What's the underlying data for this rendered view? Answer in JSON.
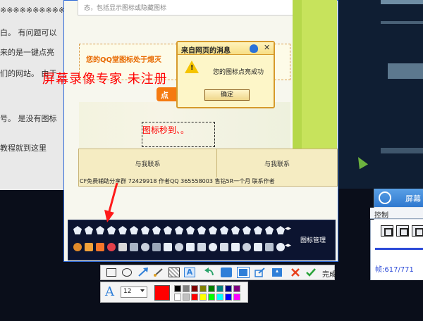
{
  "background_article": {
    "lines": [
      "※※※※※※※※※※※",
      "白。 有问题可以",
      "来的是一键点亮",
      "们的网站。 由于",
      "号。 是没有图标",
      "    教程就到这里"
    ]
  },
  "page": {
    "article_snippet": "态，包括显示图标或隐藏图标",
    "promo_text": "您的QQ堂图标处于熄灭",
    "orange_button": "点",
    "watermark": "屏幕录像专家  未注册",
    "selection_text": "图标秒到、。",
    "contact_left": "与我联系",
    "contact_right": "与我联系",
    "contact_footer": "CF免费辅助分享群  72429918    作者QQ  365558003              售钻5R一个月  联系作者"
  },
  "dialog": {
    "title": "来自网页的消息",
    "close": "✕",
    "warning_mark": "!",
    "message": "您的图标点亮成功",
    "ok_label": "确定"
  },
  "icon_panel": {
    "label": "图标管理",
    "nav_arrows": "◂▸"
  },
  "recorder": {
    "title": "屏幕",
    "tab_label": "控制",
    "frame_text": "帧:617/771"
  },
  "toolbar": {
    "tools": [
      "rectangle",
      "ellipse",
      "arrow",
      "brush",
      "mosaic",
      "text",
      "undo",
      "save",
      "copy",
      "share",
      "pin",
      "close"
    ],
    "done_label": "完成"
  },
  "text_options": {
    "font_icon": "A",
    "font_size": "12",
    "current_color": "#ff0000",
    "palette": [
      "#000000",
      "#808080",
      "#800000",
      "#808000",
      "#008000",
      "#008080",
      "#000080",
      "#800080",
      "#ffffff",
      "#c0c0c0",
      "#ff0000",
      "#ffff00",
      "#00ff00",
      "#00ffff",
      "#0000ff",
      "#ff00ff"
    ]
  }
}
